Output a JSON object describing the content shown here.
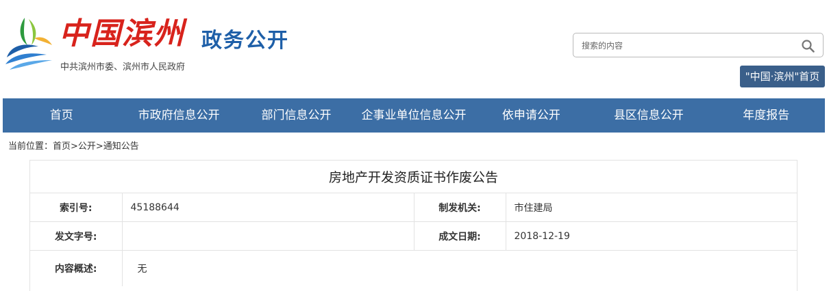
{
  "header": {
    "logo_text": "中国滨州",
    "logo_suffix": "政务公开",
    "org_line": "中共滨州市委、滨州市人民政府",
    "brand_colors": {
      "red": "#d8231c",
      "blue": "#1e5fa8",
      "nav": "#3c6ea5"
    }
  },
  "search": {
    "placeholder": "搜索的内容",
    "icon": "search-icon"
  },
  "home_link": {
    "label": "\"中国·滨州\"首页"
  },
  "nav": {
    "items": [
      "首页",
      "市政府信息公开",
      "部门信息公开",
      "企事业单位信息公开",
      "依申请公开",
      "县区信息公开",
      "年度报告"
    ]
  },
  "breadcrumb": {
    "text": "当前位置：首页>公开>通知公告"
  },
  "article": {
    "title": "房地产开发资质证书作废公告",
    "fields": {
      "index_label": "索引号:",
      "index_value": "45188644",
      "issuer_label": "制发机关:",
      "issuer_value": "市住建局",
      "doc_no_label": "发文字号:",
      "doc_no_value": "",
      "date_label": "成文日期:",
      "date_value": "2018-12-19",
      "summary_label": "内容概述:",
      "summary_value": "无"
    }
  }
}
